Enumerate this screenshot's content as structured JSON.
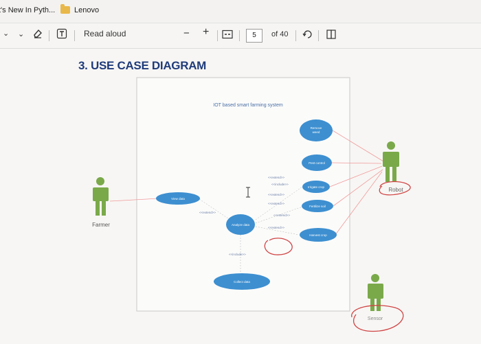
{
  "bookmarks": {
    "item1": "t's New In Pyth...",
    "item2": "Lenovo"
  },
  "toolbar": {
    "read_aloud": "Read aloud",
    "zoom_out": "−",
    "zoom_in": "+",
    "page_current": "5",
    "page_total": "of 40"
  },
  "document": {
    "heading": "3. USE CASE DIAGRAM",
    "diagram_title": "IOT based smart farming system",
    "actors": {
      "farmer": "Farmer",
      "robot": "Robot",
      "sensor": "Sensor"
    },
    "use_cases": {
      "remove_weed": [
        "Remove",
        "weed"
      ],
      "pest_control": "Pest control",
      "irrigate_crop": "Irrigate crop",
      "fertilize_soil": "Fertilize soil",
      "harvest_crop": "Harvest crop",
      "view_data": "View data",
      "analyze_data": "Analyze data",
      "collect_data": "Collect data"
    },
    "relations": {
      "extend": "<<extend>>",
      "include": "<<include>>"
    }
  },
  "colors": {
    "use_case": "#3d8fd0",
    "actor": "#7aa94a",
    "red_mark": "#d04545",
    "link": "#f08080",
    "heading": "#1f3b7a"
  }
}
